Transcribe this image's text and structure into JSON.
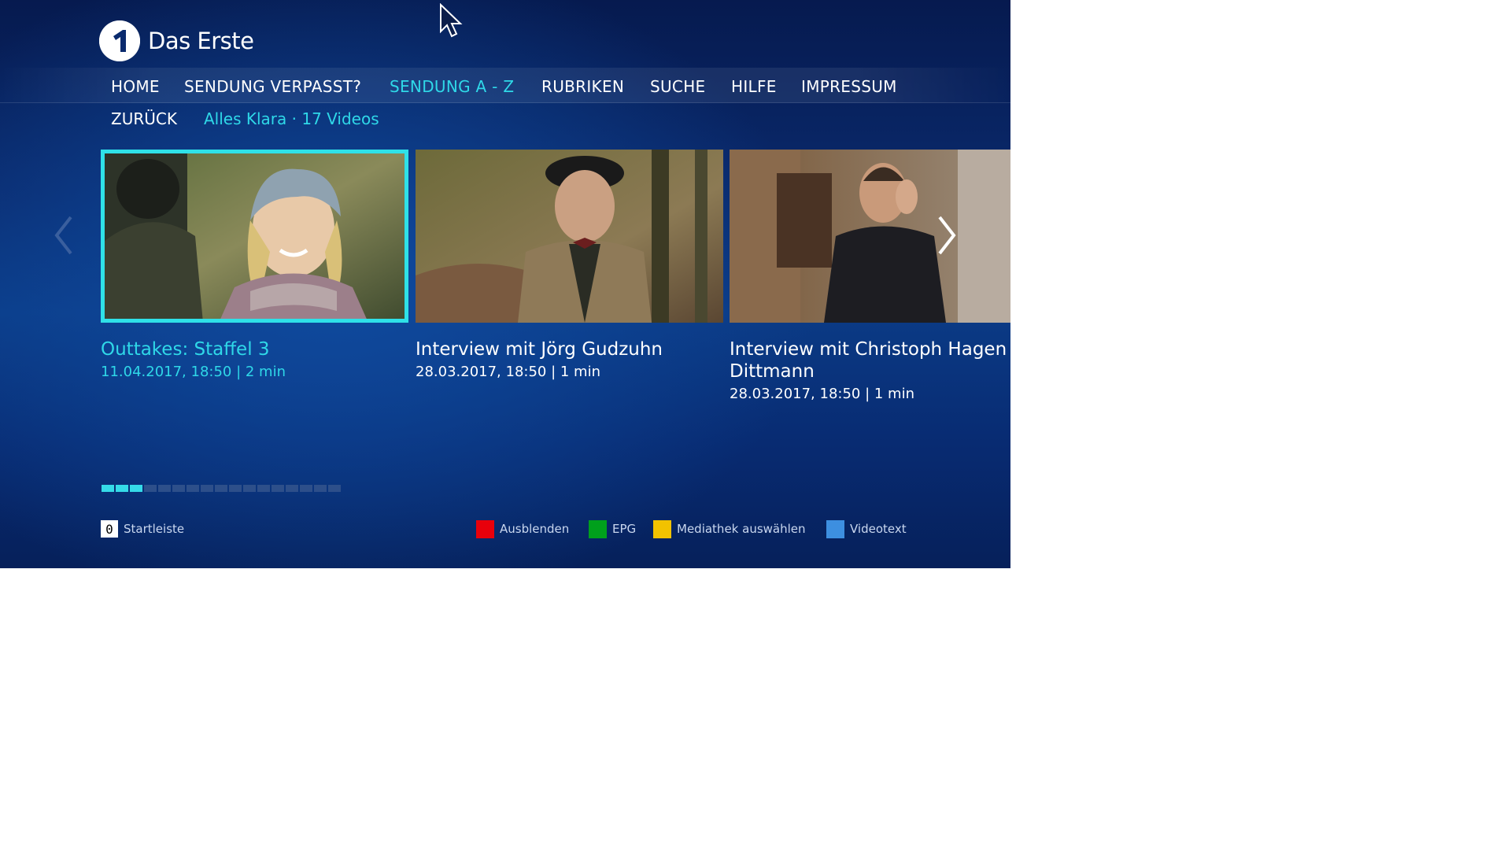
{
  "brand": {
    "name": "Das Erste"
  },
  "nav": {
    "items": [
      {
        "label": "HOME"
      },
      {
        "label": "SENDUNG VERPASST?"
      },
      {
        "label": "SENDUNG A - Z"
      },
      {
        "label": "RUBRIKEN"
      },
      {
        "label": "SUCHE"
      },
      {
        "label": "HILFE"
      },
      {
        "label": "IMPRESSUM"
      }
    ],
    "active": "SENDUNG A - Z"
  },
  "subnav": {
    "back_label": "ZURÜCK",
    "series_label": "Alles Klara · 17 Videos"
  },
  "videos": [
    {
      "title": "Outtakes: Staffel 3",
      "meta": "11.04.2017, 18:50 | 2 min",
      "selected": true
    },
    {
      "title": "Interview mit Jörg Gudzuhn",
      "meta": "28.03.2017, 18:50 | 1 min",
      "selected": false
    },
    {
      "title_line1": "Interview mit Christoph Hagen",
      "title_line2": "Dittmann",
      "meta": "28.03.2017, 18:50 | 1 min",
      "selected": false
    }
  ],
  "pagination": {
    "total": 17,
    "highlighted": 3
  },
  "footer": {
    "key0": "0",
    "startleiste": "Startleiste",
    "red": "Ausblenden",
    "green": "EPG",
    "yellow": "Mediathek auswählen",
    "blue": "Videotext"
  },
  "colors": {
    "accent": "#2fd8e8",
    "red": "#e8000b",
    "green": "#00a01c",
    "yellow": "#f2c200",
    "blue": "#3d8fe0"
  }
}
